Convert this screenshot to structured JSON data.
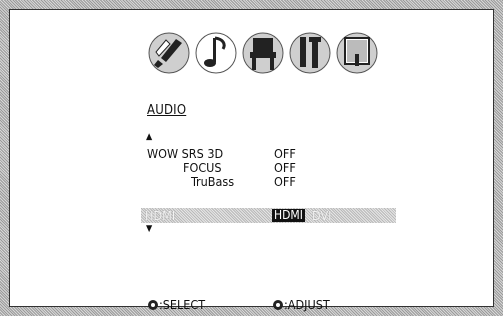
{
  "menu": {
    "icons": [
      "paintbrush-icon",
      "music-note-icon",
      "chair-icon",
      "tools-icon",
      "lock-icon"
    ],
    "title": "AUDIO",
    "rows": [
      {
        "label": "WOW SRS 3D",
        "value": "OFF"
      },
      {
        "label": "FOCUS",
        "value": "OFF"
      },
      {
        "label": "TruBass",
        "value": "OFF"
      }
    ],
    "highlighted": {
      "label": "HDMI",
      "selected_option": "HDMI",
      "other_option": "DVI"
    }
  },
  "footer": {
    "select_label": ":SELECT",
    "adjust_label": ":ADJUST"
  }
}
